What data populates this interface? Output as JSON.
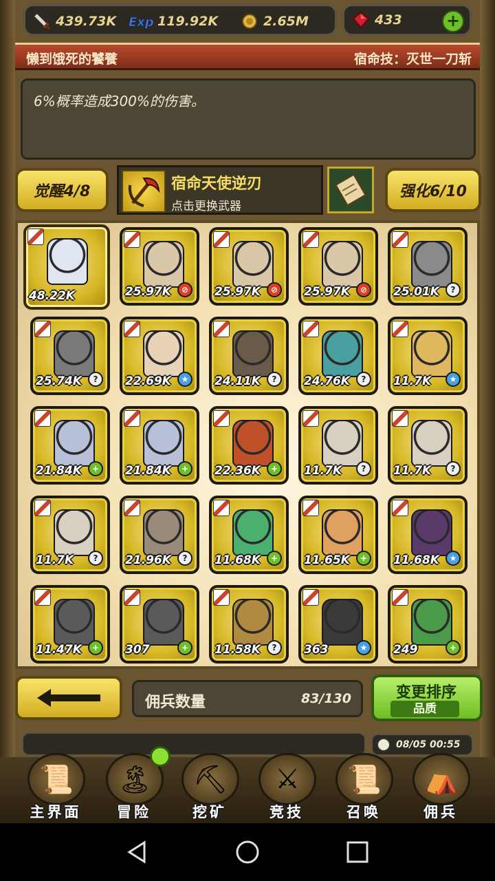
{
  "resources": {
    "attack": "439.73K",
    "exp": "119.92K",
    "gold": "2.65M",
    "gems": "433"
  },
  "header": {
    "title": "懒到饿死的饕餮",
    "skill": "宿命技：灭世一刀斩"
  },
  "description": "6%概率造成300%的伤害。",
  "awaken_label": "觉醒4/8",
  "weapon": {
    "name": "宿命天使逆刃",
    "subtitle": "点击更换武器"
  },
  "enhance_label": "强化6/10",
  "heroes": [
    {
      "value": "48.22K",
      "badge": "",
      "color": "#dfe6f0",
      "selected": true
    },
    {
      "value": "25.97K",
      "badge": "red",
      "color": "#d9c7a8"
    },
    {
      "value": "25.97K",
      "badge": "red",
      "color": "#d9c7a8"
    },
    {
      "value": "25.97K",
      "badge": "red",
      "color": "#d9c7a8"
    },
    {
      "value": "25.01K",
      "badge": "white",
      "color": "#8a8a8a"
    },
    {
      "value": "25.74K",
      "badge": "white",
      "color": "#7a7a7a"
    },
    {
      "value": "22.69K",
      "badge": "blue",
      "color": "#e8d2b8"
    },
    {
      "value": "24.11K",
      "badge": "white",
      "color": "#6a5a4a"
    },
    {
      "value": "24.76K",
      "badge": "white",
      "color": "#4aa0a0"
    },
    {
      "value": "11.7K",
      "badge": "blue",
      "color": "#e0b860"
    },
    {
      "value": "21.84K",
      "badge": "green",
      "color": "#b8c0d8"
    },
    {
      "value": "21.84K",
      "badge": "green",
      "color": "#b8c0d8"
    },
    {
      "value": "22.36K",
      "badge": "green",
      "color": "#c0502a"
    },
    {
      "value": "11.7K",
      "badge": "white",
      "color": "#d8d0c0"
    },
    {
      "value": "11.7K",
      "badge": "white",
      "color": "#d8d0c0"
    },
    {
      "value": "11.7K",
      "badge": "white",
      "color": "#d8d0c0"
    },
    {
      "value": "21.96K",
      "badge": "white",
      "color": "#9a8a7a"
    },
    {
      "value": "11.68K",
      "badge": "green",
      "color": "#4ab070"
    },
    {
      "value": "11.65K",
      "badge": "green",
      "color": "#e0a060"
    },
    {
      "value": "11.68K",
      "badge": "blue",
      "color": "#5a3a6a"
    },
    {
      "value": "11.47K",
      "badge": "green",
      "color": "#5a5a5a"
    },
    {
      "value": "307",
      "badge": "green",
      "color": "#5a5a5a"
    },
    {
      "value": "11.58K",
      "badge": "white",
      "color": "#b08a40"
    },
    {
      "value": "363",
      "badge": "blue",
      "color": "#3a3a3a"
    },
    {
      "value": "249",
      "badge": "green",
      "color": "#4a9a4a"
    }
  ],
  "footer": {
    "count_label": "佣兵数量",
    "count_value": "83/130",
    "sort_label": "变更排序",
    "sort_mode": "品质"
  },
  "clock": "08/05 00:55",
  "nav": [
    {
      "label": "主界面",
      "icon": "map-scroll-icon"
    },
    {
      "label": "冒险",
      "icon": "island-icon"
    },
    {
      "label": "挖矿",
      "icon": "pickaxe-icon"
    },
    {
      "label": "竞技",
      "icon": "crossed-swords-icon"
    },
    {
      "label": "召唤",
      "icon": "summon-scroll-icon"
    },
    {
      "label": "佣兵",
      "icon": "tent-icon"
    }
  ],
  "colors": {
    "gold_button": "#d3ad22",
    "green_button": "#6dbd23",
    "title_red": "#b74a2c"
  }
}
